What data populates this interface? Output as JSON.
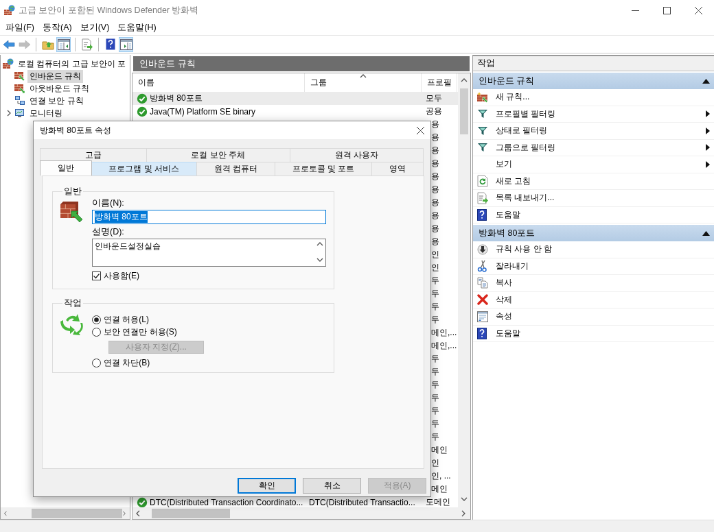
{
  "window": {
    "title": "고급 보안이 포함된 Windows Defender 방화벽"
  },
  "menu": [
    "파일(F)",
    "동작(A)",
    "보기(V)",
    "도움말(H)"
  ],
  "toolbar": [
    {
      "kind": "back",
      "pressed": false,
      "disabled": false
    },
    {
      "kind": "forward",
      "pressed": false,
      "disabled": true
    },
    {
      "kind": "up",
      "pressed": false,
      "disabled": false
    },
    {
      "kind": "tree",
      "pressed": true,
      "disabled": false
    },
    {
      "kind": "export",
      "pressed": false,
      "disabled": false
    },
    {
      "kind": "help",
      "pressed": false,
      "disabled": false
    },
    {
      "kind": "pane",
      "pressed": true,
      "disabled": false
    }
  ],
  "tree": {
    "root": {
      "label": "로컬 컴퓨터의 고급 보안이 포",
      "selected": false
    },
    "items": [
      {
        "label": "인바운드 규칙",
        "kind": "inbound",
        "selected": true,
        "expandable": false
      },
      {
        "label": "아웃바운드 규칙",
        "kind": "outbound",
        "selected": false,
        "expandable": false
      },
      {
        "label": "연결 보안 규칙",
        "kind": "computers",
        "selected": false,
        "expandable": false
      },
      {
        "label": "모니터링",
        "kind": "monitor",
        "selected": false,
        "expandable": true
      }
    ]
  },
  "rules_panel": {
    "title": "인바운드 규칙",
    "columns": [
      {
        "label": "이름",
        "sorted": false
      },
      {
        "label": "그룹",
        "sorted": true
      },
      {
        "label": "프로필",
        "sorted": false
      }
    ],
    "rows": [
      {
        "kind": "full",
        "name": "방화벽 80포트",
        "profile": "모두",
        "enabled": true,
        "selected": true
      },
      {
        "kind": "full",
        "name": "Java(TM) Platform SE binary",
        "profile": "공용",
        "enabled": true,
        "selected": false
      },
      {
        "kind": "partial",
        "profile": "용",
        "selected": false
      },
      {
        "kind": "partial",
        "profile": "용",
        "selected": false
      },
      {
        "kind": "partial",
        "profile": "용",
        "selected": false
      },
      {
        "kind": "partial",
        "profile": "용",
        "selected": false
      },
      {
        "kind": "partial",
        "profile": "용",
        "selected": false
      },
      {
        "kind": "partial",
        "profile": "용",
        "selected": false
      },
      {
        "kind": "partial",
        "profile": "용",
        "selected": false
      },
      {
        "kind": "partial",
        "profile": "용",
        "selected": false
      },
      {
        "kind": "partial",
        "profile": "용",
        "selected": false
      },
      {
        "kind": "partial",
        "profile": "용",
        "selected": false
      },
      {
        "kind": "partial",
        "profile": "인",
        "selected": false
      },
      {
        "kind": "partial",
        "profile": "인",
        "selected": false
      },
      {
        "kind": "partial",
        "profile": "두",
        "selected": false
      },
      {
        "kind": "partial",
        "profile": "두",
        "selected": false
      },
      {
        "kind": "partial",
        "profile": "두",
        "selected": false
      },
      {
        "kind": "partial",
        "profile": "두",
        "selected": false
      },
      {
        "kind": "partial",
        "profile": "메인,...",
        "selected": false
      },
      {
        "kind": "partial",
        "profile": "메인,...",
        "selected": false
      },
      {
        "kind": "partial",
        "profile": "두",
        "selected": false
      },
      {
        "kind": "partial",
        "profile": "두",
        "selected": false
      },
      {
        "kind": "partial",
        "profile": "두",
        "selected": false
      },
      {
        "kind": "partial",
        "profile": "두",
        "selected": false
      },
      {
        "kind": "partial",
        "profile": "두",
        "selected": false
      },
      {
        "kind": "partial",
        "profile": "두",
        "selected": false
      },
      {
        "kind": "partial",
        "profile": "두",
        "selected": false
      },
      {
        "kind": "partial",
        "profile": "메인",
        "selected": false
      },
      {
        "kind": "partial",
        "profile": "인",
        "selected": false
      },
      {
        "kind": "partial",
        "profile": "인, ...",
        "selected": false
      },
      {
        "kind": "partial",
        "profile": "메인",
        "selected": false
      },
      {
        "kind": "full",
        "name": "DTC(Distributed Transaction Coordinato...",
        "group": "DTC(Distributed Transactio...",
        "profile": "도메인",
        "enabled": true,
        "selected": false
      }
    ]
  },
  "actions": {
    "title": "작업",
    "sections": [
      {
        "title": "인바운드 규칙",
        "expanded": true,
        "items": [
          {
            "label": "새 규칙...",
            "kind": "new-rule",
            "submenu": false
          },
          {
            "label": "프로필별 필터링",
            "kind": "filter",
            "submenu": true
          },
          {
            "label": "상태로 필터링",
            "kind": "filter",
            "submenu": true
          },
          {
            "label": "그룹으로 필터링",
            "kind": "filter",
            "submenu": true
          },
          {
            "label": "보기",
            "submenu": true
          },
          {
            "label": "새로 고침",
            "kind": "refresh",
            "submenu": false
          },
          {
            "label": "목록 내보내기...",
            "kind": "export",
            "submenu": false
          },
          {
            "label": "도움말",
            "kind": "help",
            "submenu": false
          }
        ]
      },
      {
        "title": "방화벽 80포트",
        "expanded": true,
        "items": [
          {
            "label": "규칙 사용 안 함",
            "kind": "disable",
            "submenu": false
          },
          {
            "label": "잘라내기",
            "kind": "cut",
            "submenu": false
          },
          {
            "label": "복사",
            "kind": "copy",
            "submenu": false
          },
          {
            "label": "삭제",
            "kind": "delete",
            "submenu": false
          },
          {
            "label": "속성",
            "kind": "properties",
            "submenu": false
          },
          {
            "label": "도움말",
            "kind": "help",
            "submenu": false
          }
        ]
      }
    ]
  },
  "dialog": {
    "title": "방화벽 80포트 속성",
    "tab_rows": [
      [
        {
          "label": "고급",
          "selected": false,
          "hovered": false
        },
        {
          "label": "로컬 보안 주체",
          "selected": false,
          "hovered": false
        },
        {
          "label": "원격 사용자",
          "selected": false,
          "hovered": false
        }
      ],
      [
        {
          "label": "일반",
          "selected": true,
          "hovered": false
        },
        {
          "label": "프로그램 및 서비스",
          "selected": false,
          "hovered": true
        },
        {
          "label": "원격 컴퓨터",
          "selected": false,
          "hovered": false
        },
        {
          "label": "프로토콜 및 포트",
          "selected": false,
          "hovered": false
        },
        {
          "label": "영역",
          "selected": false,
          "hovered": false
        }
      ]
    ],
    "general": {
      "title": "일반",
      "name_label": "이름(N):",
      "name_value": "방화벽 80포트",
      "name_value_selected": true,
      "description_label": "설명(D):",
      "description_value": "인바운드설정실습",
      "enabled": {
        "label": "사용함(E)",
        "checked": true
      }
    },
    "action": {
      "title": "작업",
      "items": [
        {
          "kind": "radio",
          "label": "연결 허용(L)",
          "selected": true
        },
        {
          "kind": "radio",
          "label": "보안 연결만 허용(S)",
          "selected": false
        },
        {
          "kind": "button",
          "label": "사용자 지정(Z)...",
          "disabled": true
        },
        {
          "kind": "radio",
          "label": "연결 차단(B)",
          "selected": false
        }
      ]
    },
    "buttons": [
      {
        "label": "확인",
        "default": true,
        "disabled": false
      },
      {
        "label": "취소",
        "default": false,
        "disabled": false
      },
      {
        "label": "적용(A)",
        "default": false,
        "disabled": true
      }
    ]
  }
}
